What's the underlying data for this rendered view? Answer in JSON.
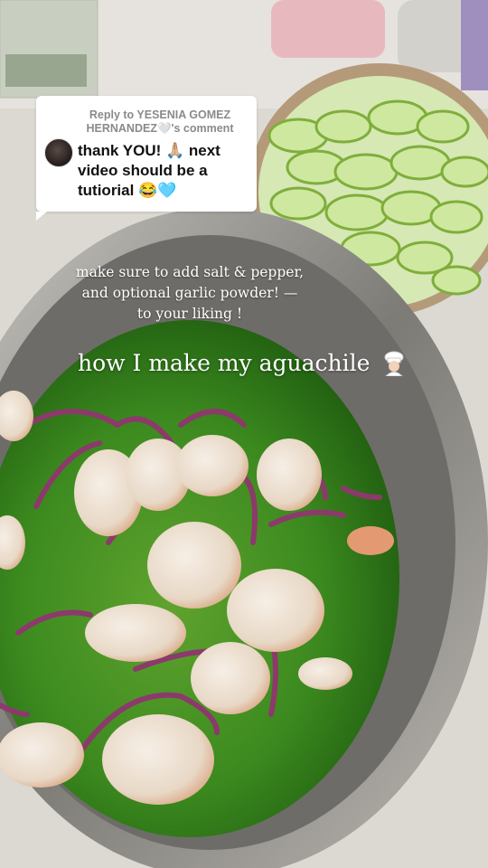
{
  "reply": {
    "header_prefix": "Reply to YESENIA GOMEZ",
    "header_name_line2": "HERNANDEZ🤍's comment",
    "body": "thank YOU! 🙏🏼 next video should be a tutiorial 😂🩵"
  },
  "caption": {
    "line1": "make sure to add salt & pepper,",
    "line2": "and optional garlic powder! —",
    "line3": "to your liking !"
  },
  "title": "how I make my aguachile",
  "icons": {
    "chef": "chef-emoji-icon",
    "avatar": "commenter-avatar"
  },
  "colors": {
    "sauce_green": "#3c8a1f",
    "bowl_steel": "#9a9a96",
    "counter": "#d9d6d0"
  }
}
